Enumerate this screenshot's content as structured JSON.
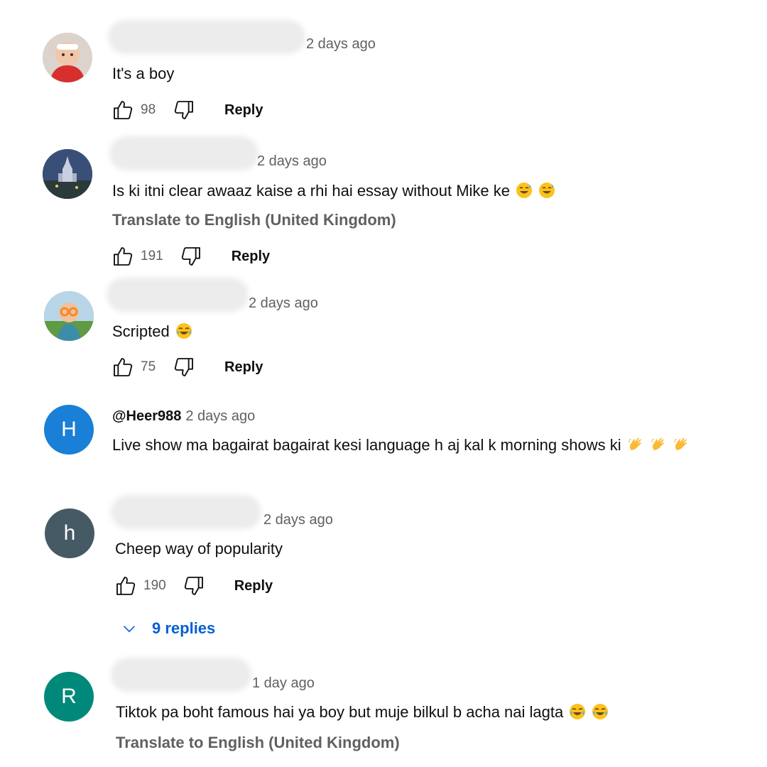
{
  "comments": [
    {
      "author": "",
      "time": "2 days ago",
      "text": "It's a boy",
      "likes": "98",
      "reply": "Reply"
    },
    {
      "author": "",
      "time": "2 days ago",
      "text": "Is ki itni clear awaaz kaise a rhi hai essay without Mike ke",
      "emoji": [
        "sweat-smile",
        "sweat-smile"
      ],
      "translate": "Translate to English (United Kingdom)",
      "likes": "191",
      "reply": "Reply"
    },
    {
      "author": "",
      "time": "2 days ago",
      "text": "Scripted",
      "emoji": [
        "joy"
      ],
      "likes": "75",
      "reply": "Reply"
    },
    {
      "author": "@Heer988",
      "avatar_letter": "H",
      "avatar_color": "#1a7fd6",
      "time": "2 days ago",
      "text": "Live show ma bagairat bagairat kesi language h aj kal k morning shows ki",
      "emoji": [
        "clap",
        "clap",
        "clap"
      ]
    },
    {
      "author": "",
      "avatar_letter": "h",
      "avatar_color": "#455a64",
      "time": "2 days ago",
      "text": "Cheep way of popularity",
      "likes": "190",
      "reply": "Reply",
      "replies": "9 replies"
    },
    {
      "author": "",
      "avatar_letter": "R",
      "avatar_color": "#00897b",
      "time": "1 day ago",
      "text": "Tiktok pa boht famous hai ya boy but muje bilkul b acha nai lagta",
      "emoji": [
        "joy",
        "joy"
      ],
      "translate": "Translate to English (United Kingdom)"
    }
  ],
  "colors": {
    "link": "#065fd4",
    "secondary": "#606060",
    "primary": "#0f0f0f"
  }
}
